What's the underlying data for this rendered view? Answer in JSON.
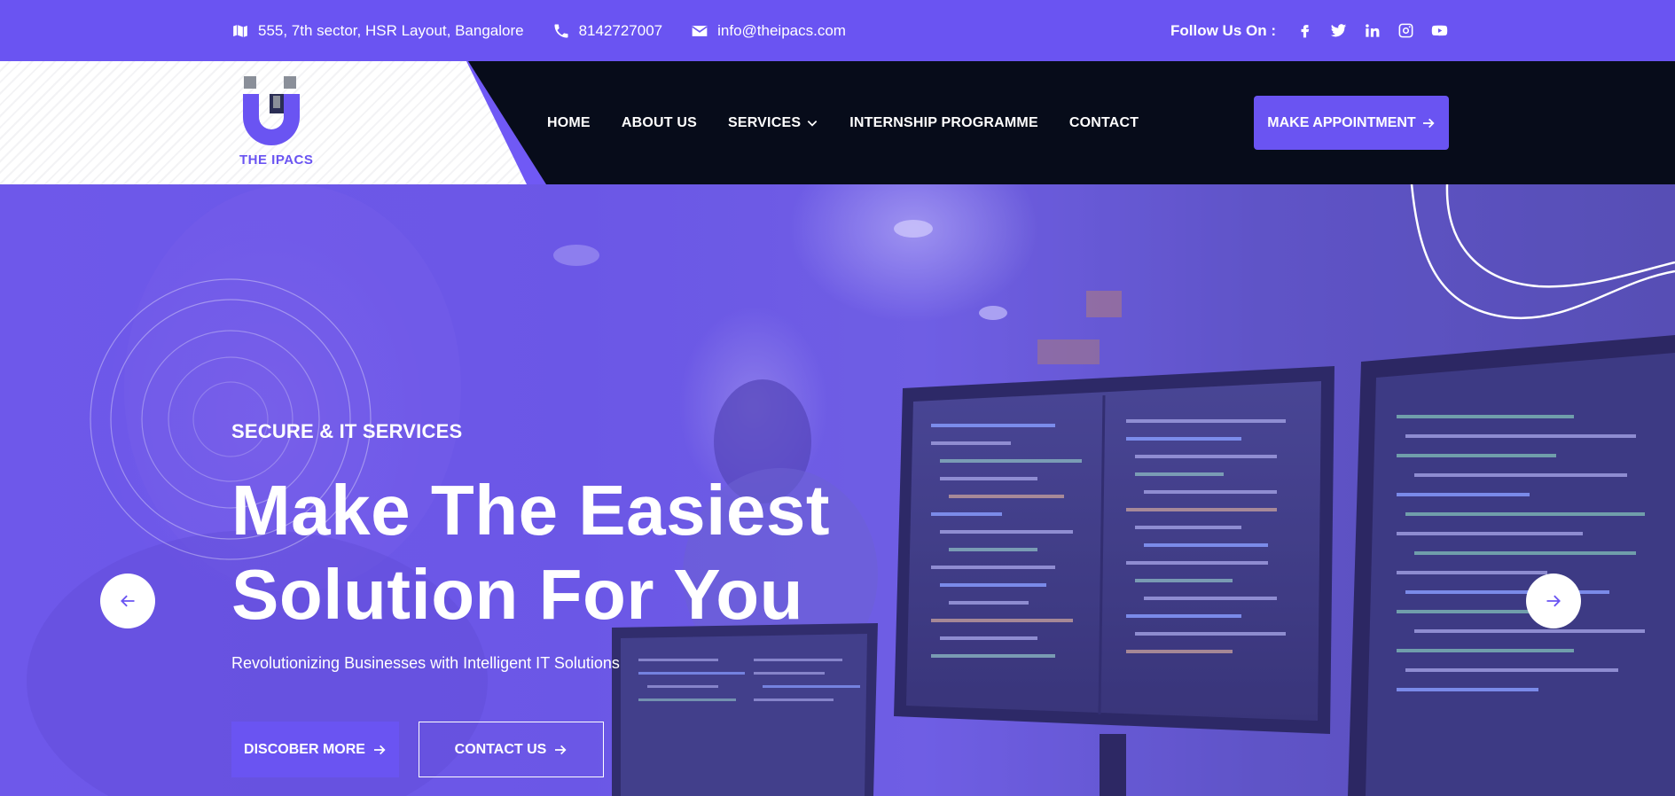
{
  "topbar": {
    "address": "555, 7th sector, HSR Layout, Bangalore",
    "phone": "8142727007",
    "email": "info@theipacs.com",
    "follow_label": "Follow Us On :",
    "social_icons": [
      "facebook-icon",
      "twitter-icon",
      "linkedin-icon",
      "instagram-icon",
      "youtube-icon"
    ]
  },
  "brand": {
    "logo_text": "THE IPACS",
    "accent_color": "#6a54f2",
    "dark_color": "#070c1a"
  },
  "nav": {
    "items": [
      {
        "label": "HOME"
      },
      {
        "label": "ABOUT US"
      },
      {
        "label": "SERVICES",
        "dropdown": true
      },
      {
        "label": "INTERNSHIP PROGRAMME"
      },
      {
        "label": "CONTACT"
      }
    ],
    "cta_label": "MAKE APPOINTMENT"
  },
  "hero": {
    "eyebrow": "SECURE & IT SERVICES",
    "headline_line1": "Make The Easiest",
    "headline_line2": "Solution For You",
    "subtitle": "Revolutionizing Businesses with Intelligent IT Solutions",
    "primary_button": "DISCOBER MORE",
    "secondary_button": "CONTACT US"
  }
}
